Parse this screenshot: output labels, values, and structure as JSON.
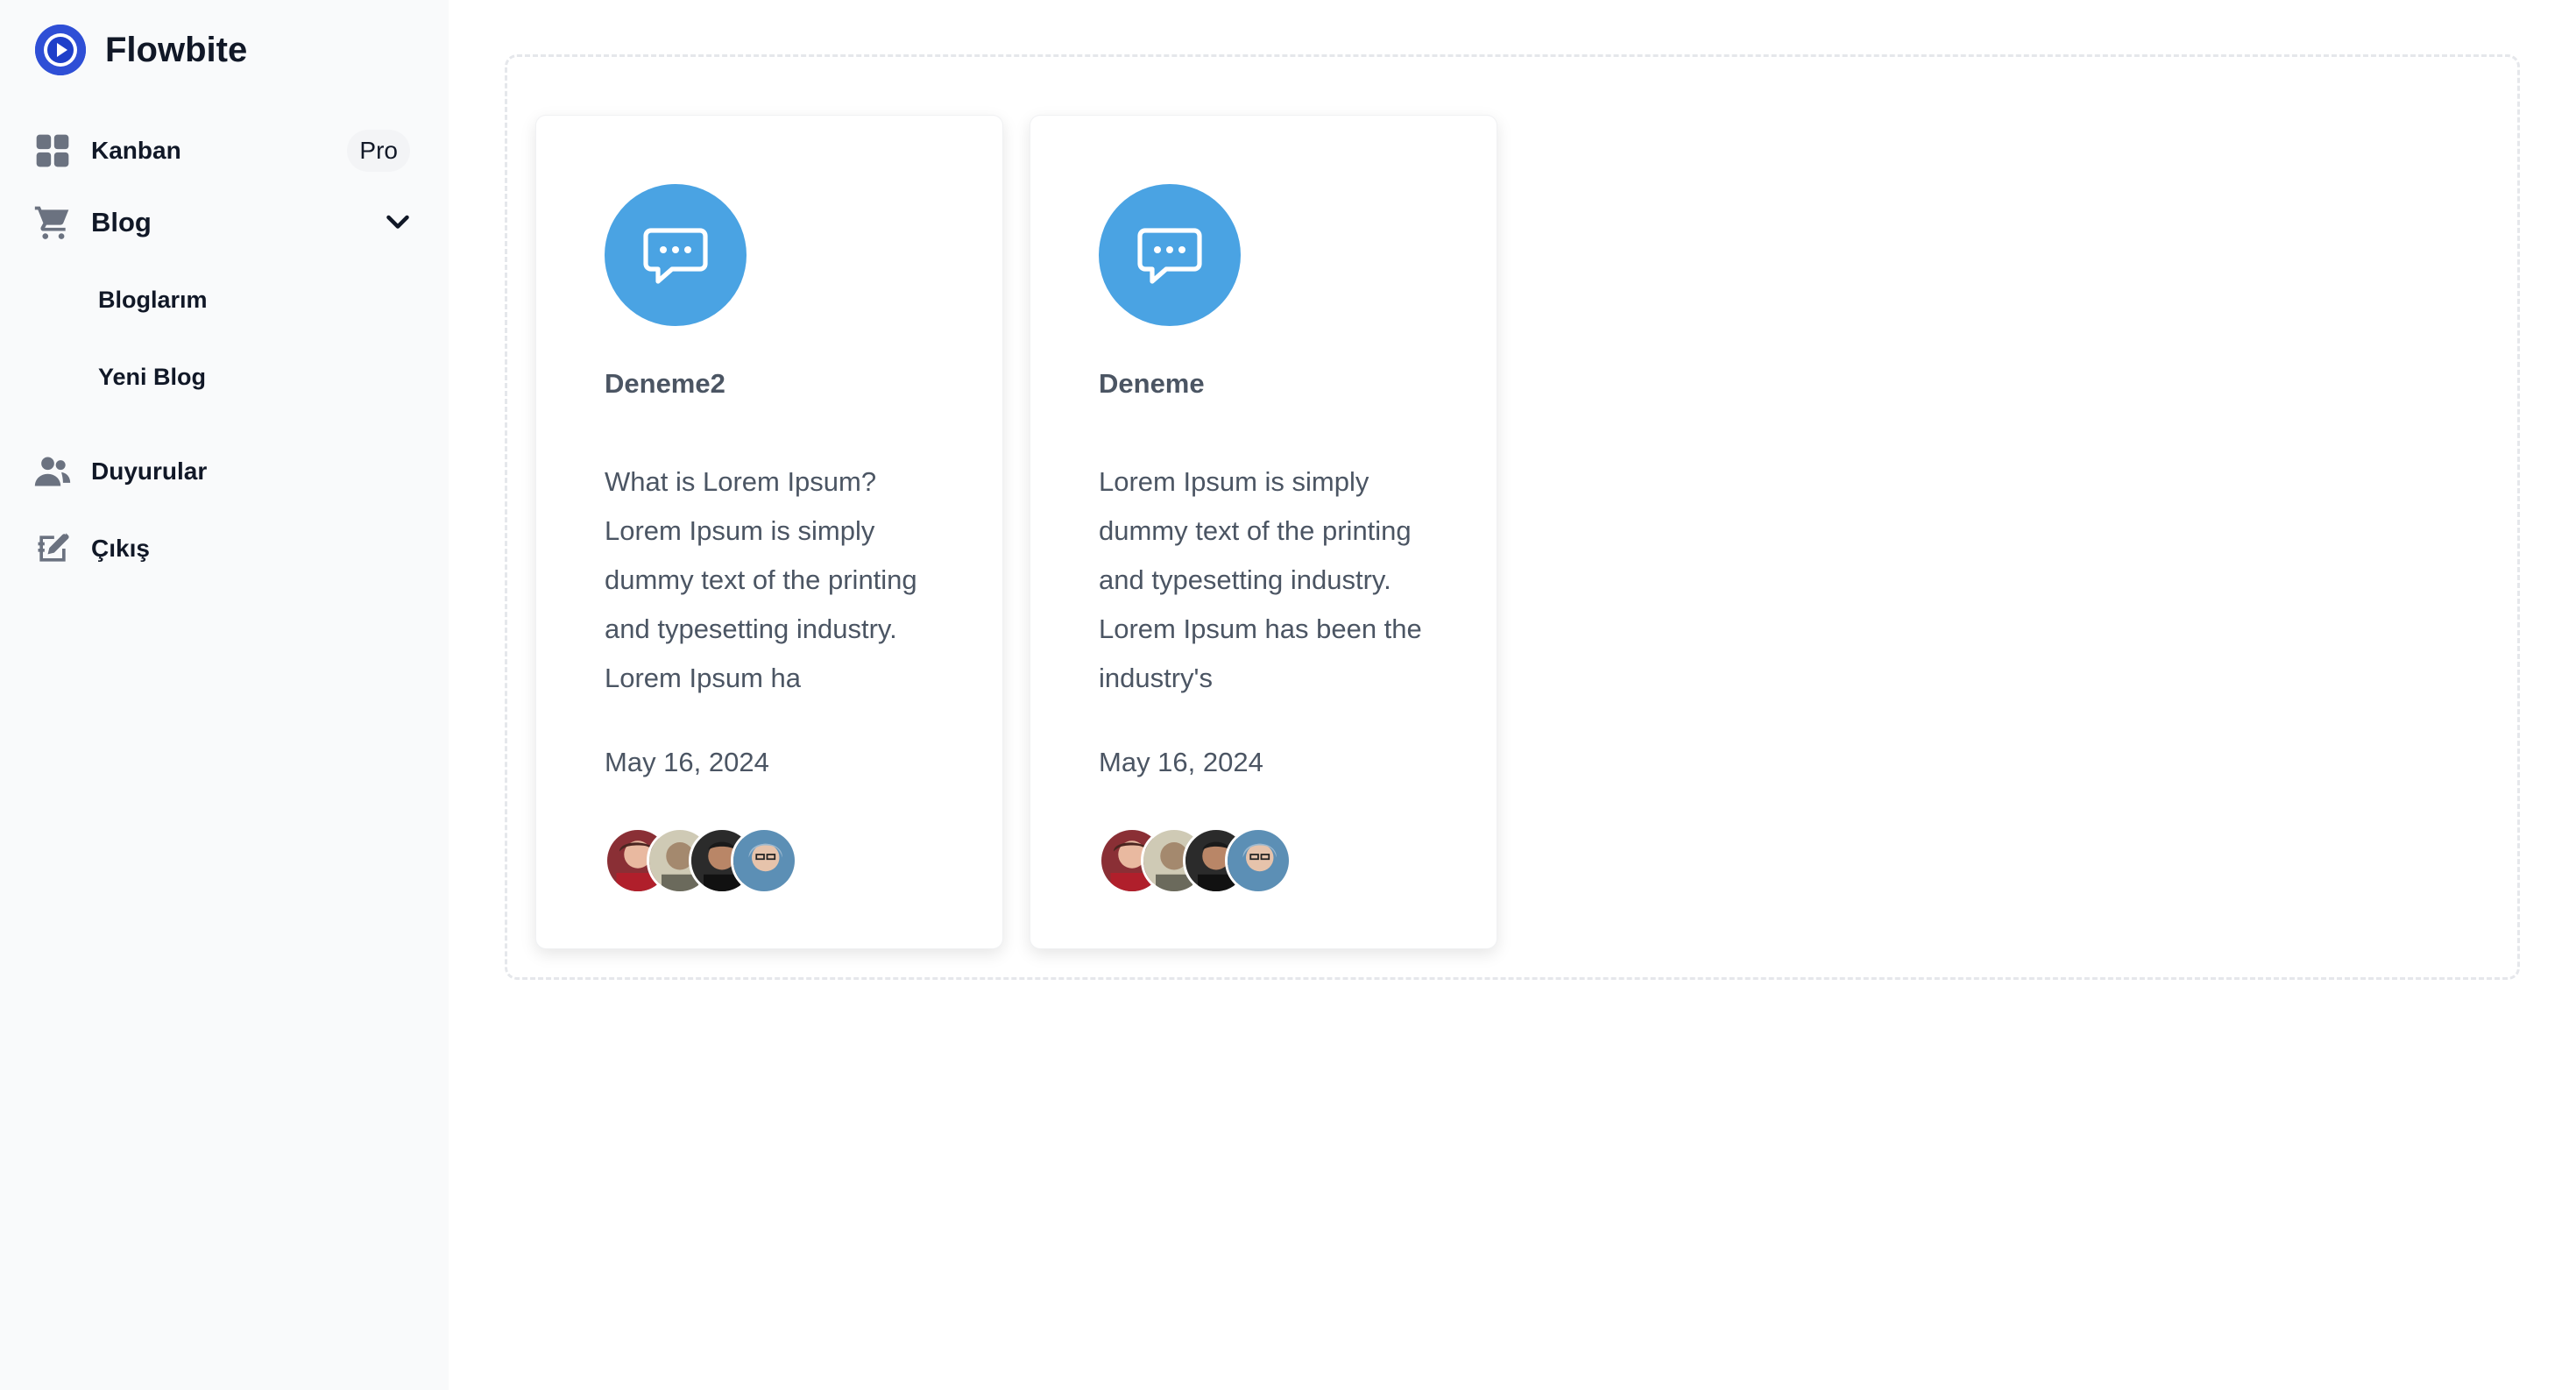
{
  "brand": {
    "name": "Flowbite",
    "logo_icon": "play-circle-icon",
    "logo_color": "#1d4ed8"
  },
  "sidebar": {
    "items": [
      {
        "label": "Kanban",
        "icon": "grid-icon",
        "badge": "Pro"
      },
      {
        "label": "Blog",
        "icon": "cart-icon",
        "expanded": true,
        "children": [
          {
            "label": "Bloglarım"
          },
          {
            "label": "Yeni Blog"
          }
        ]
      },
      {
        "label": "Duyurular",
        "icon": "users-icon"
      },
      {
        "label": "Çıkış",
        "icon": "edit-icon"
      }
    ]
  },
  "cards": [
    {
      "title": "Deneme2",
      "excerpt": "What is Lorem Ipsum? Lorem Ipsum is simply dummy text of the printing and typesetting industry. Lorem Ipsum ha",
      "date": "May 16, 2024",
      "icon": "chat-bubble-icon",
      "avatar_count": 4
    },
    {
      "title": "Deneme",
      "excerpt": "Lorem Ipsum is simply dummy text of the printing and typesetting industry. Lorem Ipsum has been the industry's",
      "date": "May 16, 2024",
      "icon": "chat-bubble-icon",
      "avatar_count": 4
    }
  ],
  "colors": {
    "accent": "#4aa3e3",
    "sidebar_bg": "#f9fafb",
    "text_muted": "#4b5563"
  }
}
